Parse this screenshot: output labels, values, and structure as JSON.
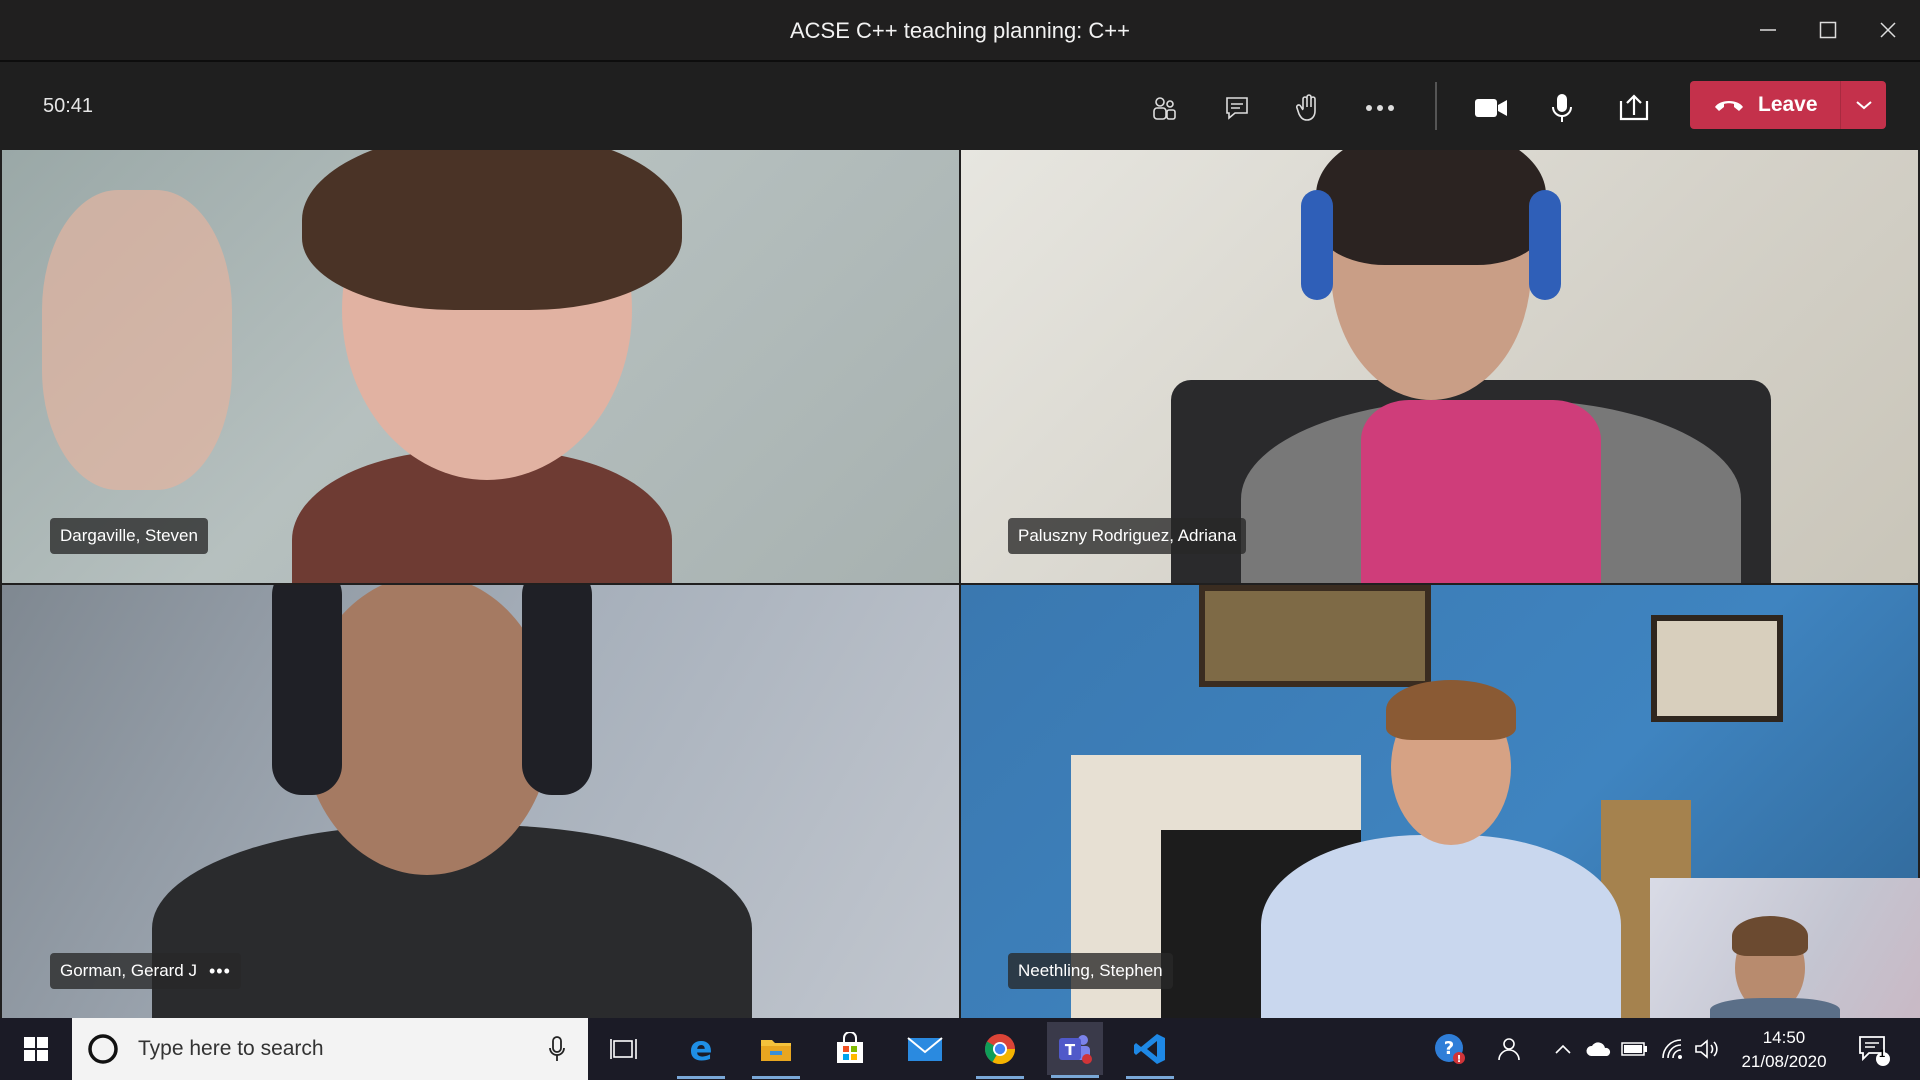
{
  "window": {
    "title": "ACSE C++ teaching planning: C++"
  },
  "toolbar": {
    "timer": "50:41",
    "leave_label": "Leave",
    "icons": [
      "participants-icon",
      "chat-icon",
      "raise-hand-icon",
      "more-actions-icon",
      "camera-icon",
      "microphone-icon",
      "share-screen-icon",
      "phone-hangup-icon",
      "chevron-down-icon"
    ]
  },
  "participants": [
    {
      "name": "Dargaville, Steven"
    },
    {
      "name": "Paluszny Rodriguez, Adriana"
    },
    {
      "name": "Gorman, Gerard J",
      "more": "•••"
    },
    {
      "name": "Neethling, Stephen"
    }
  ],
  "taskbar": {
    "search_placeholder": "Type here to search",
    "apps": [
      "task-view-icon",
      "edge-icon",
      "file-explorer-icon",
      "store-icon",
      "mail-icon",
      "chrome-icon",
      "teams-icon",
      "vscode-icon"
    ],
    "time": "14:50",
    "date": "21/08/2020",
    "notification_count": "1"
  },
  "colors": {
    "leave": "#c4314b",
    "titlebar": "#201f1f",
    "taskbar": "#1b1b26"
  }
}
